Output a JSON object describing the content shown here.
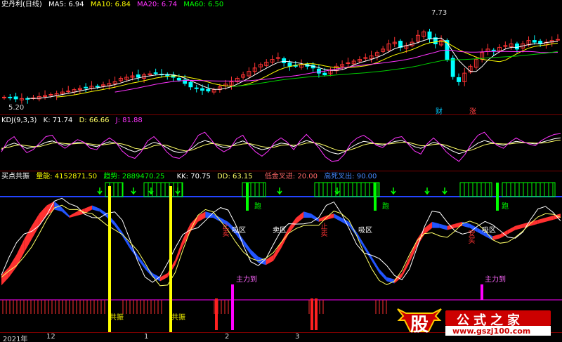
{
  "header_price": {
    "stock_name": "史丹利(日线)",
    "ma": [
      {
        "label": "MA5: 6.94",
        "color": "#ffffff"
      },
      {
        "label": "MA10: 6.84",
        "color": "#ffff00"
      },
      {
        "label": "MA20: 6.74",
        "color": "#ff33ff"
      },
      {
        "label": "MA60: 6.50",
        "color": "#00ff00"
      }
    ]
  },
  "price_annotations": {
    "high": "7.73",
    "low": "5.20",
    "event1": "财",
    "event2": "涨"
  },
  "header_kdj": {
    "title": "KDJ(9,3,3)",
    "k": "K: 71.74",
    "d": "D: 66.66",
    "j": "J: 81.88"
  },
  "header_ind": {
    "title": "买点共振",
    "volume": "量能: 4152871.50",
    "trend": "趋势: 2889470.25",
    "kk": "KK: 70.75",
    "dd": "DD: 63.15",
    "low_gold": "低金叉进: 20.00",
    "high_dead": "高死叉出: 90.00"
  },
  "ind_labels": {
    "stop_sell": "止卖",
    "accumulate": "吸区",
    "buy_zone": "卖区",
    "main_arrive": "主力到",
    "resonance": "共振",
    "run": "跑",
    "buy_stop": "买",
    "safe_buy": "安买"
  },
  "x_axis": {
    "year": "2021年",
    "m12": "12",
    "m1": "1",
    "m2": "2",
    "m3": "3"
  },
  "watermark": {
    "left": "股",
    "right": "公式之家",
    "url": "www.gszj100.com"
  },
  "colors": {
    "up": "#ff3333",
    "down": "#00ffff",
    "ma5": "#ffffff",
    "ma10": "#ffff00",
    "ma20": "#ff33ff",
    "ma60": "#00cc00",
    "k": "#ffffff",
    "d": "#ffff66",
    "j": "#ff33ff",
    "red_band": "#ff3030",
    "blue_band": "#2255ff",
    "yellow": "#ffff00",
    "green": "#00ff00",
    "magenta": "#ff00ff"
  },
  "chart_data": [
    {
      "type": "candlestick",
      "title": "史丹利(日线)",
      "ylim": [
        5.0,
        7.9
      ],
      "series": [
        {
          "name": "close",
          "values": [
            5.4,
            5.38,
            5.35,
            5.36,
            5.34,
            5.38,
            5.42,
            5.45,
            5.48,
            5.5,
            5.55,
            5.58,
            5.62,
            5.66,
            5.68,
            5.72,
            5.7,
            5.76,
            5.8,
            5.85,
            5.95,
            5.98,
            6.02,
            5.98,
            6.05,
            6.08,
            6.1,
            6.06,
            6.02,
            5.98,
            5.9,
            5.8,
            5.7,
            5.65,
            5.6,
            5.58,
            5.62,
            5.7,
            5.78,
            5.85,
            5.95,
            6.05,
            6.15,
            6.25,
            6.35,
            6.42,
            6.5,
            6.55,
            6.4,
            6.3,
            6.3,
            6.35,
            6.3,
            6.25,
            6.1,
            6.05,
            6.2,
            6.3,
            6.35,
            6.4,
            6.45,
            6.5,
            6.55,
            6.6,
            6.7,
            6.8,
            6.95,
            7.0,
            6.85,
            6.9,
            7.0,
            7.2,
            7.3,
            7.1,
            6.95,
            7.05,
            6.5,
            6.0,
            5.85,
            6.1,
            6.3,
            6.5,
            6.7,
            6.8,
            6.75,
            6.85,
            6.9,
            6.95,
            6.8,
            6.95,
            7.05,
            7.0,
            6.95,
            7.0,
            7.05,
            7.08
          ]
        }
      ]
    },
    {
      "type": "line",
      "title": "KDJ(9,3,3)",
      "ylim": [
        0,
        100
      ],
      "series": [
        {
          "name": "K",
          "values": [
            45,
            55,
            60,
            55,
            48,
            50,
            55,
            62,
            65,
            60,
            55,
            58,
            62,
            60,
            55,
            52,
            58,
            63,
            60,
            52,
            45,
            40,
            45,
            55,
            62,
            58,
            50,
            42,
            38,
            40,
            48,
            60,
            66,
            62,
            55,
            50,
            52,
            60,
            65,
            58,
            50,
            45,
            48,
            55,
            60,
            58,
            52,
            60,
            66,
            62,
            55,
            45,
            38,
            35,
            40,
            50,
            58,
            64,
            62,
            58,
            55,
            60,
            64,
            66,
            60,
            52,
            48,
            55,
            62,
            58,
            50,
            42,
            36,
            40,
            50,
            60,
            66,
            62,
            58,
            55,
            60,
            64,
            62,
            60,
            58,
            62,
            66,
            70,
            72
          ]
        },
        {
          "name": "D",
          "values": [
            48,
            50,
            54,
            56,
            54,
            52,
            52,
            56,
            60,
            61,
            59,
            58,
            59,
            60,
            58,
            56,
            56,
            58,
            60,
            58,
            54,
            48,
            46,
            48,
            54,
            56,
            55,
            50,
            45,
            42,
            44,
            50,
            56,
            59,
            58,
            55,
            53,
            55,
            58,
            59,
            56,
            52,
            50,
            51,
            55,
            56,
            55,
            56,
            60,
            61,
            59,
            54,
            48,
            43,
            42,
            45,
            50,
            56,
            59,
            59,
            58,
            58,
            60,
            62,
            62,
            58,
            54,
            54,
            57,
            58,
            55,
            50,
            45,
            42,
            44,
            50,
            56,
            59,
            59,
            58,
            58,
            60,
            61,
            61,
            60,
            60,
            62,
            65,
            67
          ]
        },
        {
          "name": "J",
          "values": [
            40,
            65,
            75,
            55,
            38,
            45,
            60,
            75,
            78,
            58,
            48,
            58,
            68,
            62,
            48,
            45,
            62,
            72,
            62,
            42,
            30,
            25,
            40,
            65,
            75,
            60,
            40,
            28,
            25,
            35,
            55,
            78,
            85,
            68,
            50,
            40,
            48,
            70,
            78,
            55,
            40,
            30,
            42,
            62,
            72,
            62,
            45,
            65,
            80,
            65,
            48,
            28,
            18,
            20,
            35,
            60,
            72,
            78,
            68,
            55,
            50,
            62,
            72,
            75,
            58,
            42,
            35,
            58,
            72,
            58,
            40,
            28,
            18,
            35,
            60,
            78,
            85,
            68,
            55,
            48,
            62,
            72,
            64,
            58,
            54,
            66,
            74,
            80,
            82
          ]
        }
      ]
    },
    {
      "type": "area",
      "title": "买点共振",
      "ylim": [
        0,
        100
      ],
      "series": [
        {
          "name": "KK",
          "values": [
            20,
            28,
            40,
            55,
            68,
            80,
            88,
            92,
            86,
            78,
            82,
            85,
            88,
            85,
            80,
            72,
            62,
            50,
            40,
            30,
            22,
            18,
            22,
            35,
            55,
            70,
            78,
            82,
            80,
            76,
            72,
            65,
            55,
            45,
            38,
            35,
            40,
            52,
            66,
            76,
            82,
            80,
            75,
            78,
            80,
            76,
            72,
            62,
            50,
            38,
            26,
            18,
            16,
            22,
            38,
            55,
            66,
            72,
            70,
            68,
            70,
            72,
            70,
            66,
            62,
            58,
            60,
            64,
            68,
            70,
            72,
            74,
            76,
            78,
            80
          ]
        },
        {
          "name": "DD",
          "values": [
            10,
            18,
            28,
            42,
            55,
            68,
            78,
            84,
            82,
            76,
            78,
            80,
            84,
            82,
            76,
            68,
            58,
            46,
            36,
            26,
            18,
            14,
            18,
            30,
            48,
            62,
            72,
            76,
            76,
            72,
            68,
            60,
            50,
            40,
            32,
            30,
            34,
            46,
            60,
            70,
            76,
            76,
            72,
            74,
            76,
            72,
            68,
            58,
            46,
            34,
            22,
            14,
            12,
            18,
            32,
            48,
            60,
            66,
            66,
            64,
            66,
            68,
            66,
            62,
            58,
            54,
            56,
            60,
            64,
            66,
            68,
            70,
            72,
            74,
            76
          ]
        }
      ]
    }
  ]
}
